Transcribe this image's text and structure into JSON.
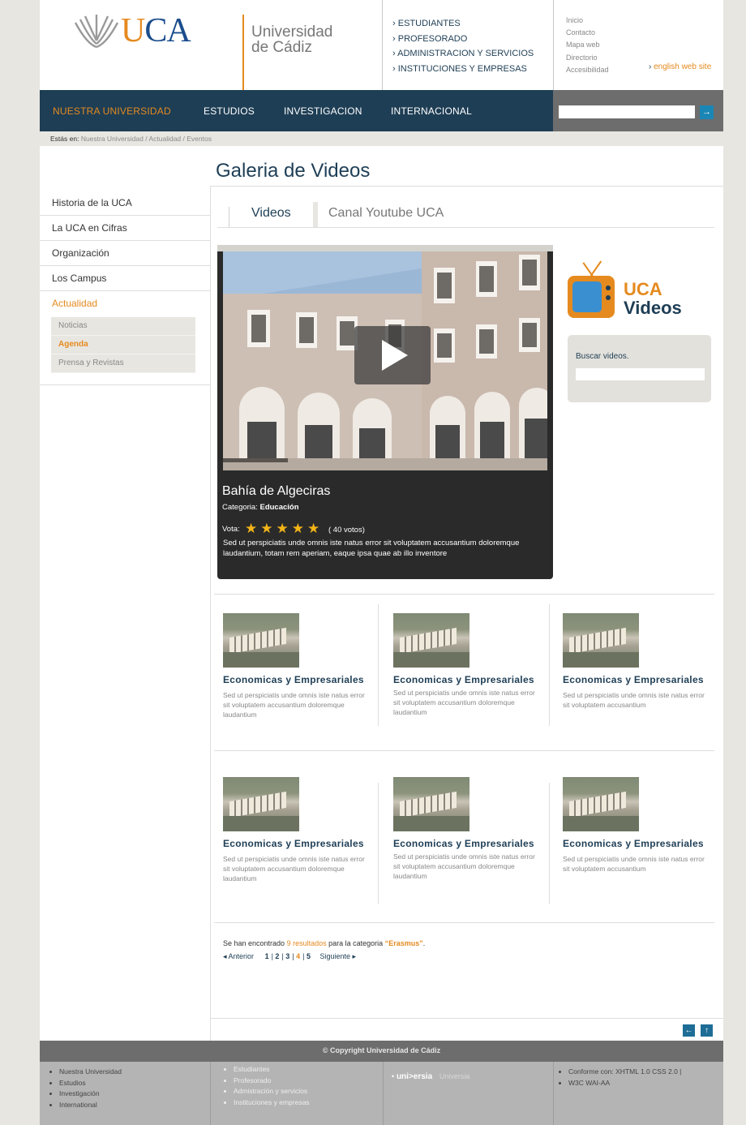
{
  "header": {
    "logo_text_u": "U",
    "logo_text_ca": "CA",
    "logo_name_line1": "Universidad",
    "logo_name_line2": "de Cádiz",
    "top_links": [
      "ESTUDIANTES",
      "PROFESORADO",
      "ADMINISTRACION Y SERVICIOS",
      "INSTITUCIONES Y EMPRESAS"
    ],
    "utility_links": [
      "Inicio",
      "Contacto",
      "Mapa web",
      "Directorio",
      "Accesibilidad"
    ],
    "english_link": "english web site"
  },
  "nav": {
    "items": [
      "NUESTRA  UNIVERSIDAD",
      "ESTUDIOS",
      "INVESTIGACION",
      "INTERNACIONAL"
    ],
    "active_index": 0,
    "search_placeholder": "",
    "search_button": "→"
  },
  "breadcrumb": {
    "prefix": "Estás en:",
    "items": [
      "Nuestra Universidad",
      "Actualidad",
      "Eventos"
    ]
  },
  "page_title": "Galeria de Videos",
  "sidebar": {
    "items": [
      "Historia de la UCA",
      "La UCA en Cifras",
      "Organización",
      "Los Campus",
      "Actualidad"
    ],
    "active_index": 4,
    "subitems": [
      "Noticias",
      "Agenda",
      "Prensa y Revistas"
    ],
    "active_sub_index": 1
  },
  "tabs": [
    "Videos",
    "Canal Youtube UCA"
  ],
  "player": {
    "title": "Bahía de Algeciras",
    "category_label": "Categoria:",
    "category": "Educación",
    "vote_label": "Vota:",
    "rating": 5,
    "votes": "( 40 votos)",
    "description": "Sed ut perspiciatis unde omnis iste natus error sit voluptatem accusantium doloremque laudantium, totam rem aperiam, eaque ipsa quae ab illo inventore"
  },
  "right": {
    "logo_line1": "UCA",
    "logo_line2": "Videos",
    "search_label": "Buscar videos."
  },
  "videos": [
    {
      "title": "Economicas y Empresariales",
      "desc": "Sed ut perspiciatis unde omnis iste natus error sit voluptatem accusantium doloremque laudantium"
    },
    {
      "title": "Economicas y Empresariales",
      "desc": "Sed ut perspiciatis unde omnis iste natus error sit voluptatem accusantium doloremque laudantium"
    },
    {
      "title": "Economicas y Empresariales",
      "desc": "Sed ut perspiciatis unde omnis iste natus error sit voluptatem accusantium"
    },
    {
      "title": "Economicas y Empresariales",
      "desc": "Sed ut perspiciatis unde omnis iste natus error sit voluptatem accusantium doloremque laudantium"
    },
    {
      "title": "Economicas y Empresariales",
      "desc": "Sed ut perspiciatis unde omnis iste natus error sit voluptatem accusantium doloremque laudantium"
    },
    {
      "title": "Economicas y Empresariales",
      "desc": "Sed ut perspiciatis unde omnis iste natus error sit voluptatem accusantium"
    }
  ],
  "results": {
    "prefix": "Se han encontrado",
    "count": "9 resultados",
    "middle": "para la categoria",
    "category": "“Erasmus”",
    "suffix": "."
  },
  "pager": {
    "prev": "◂ Anterior",
    "pages": [
      "1",
      "2",
      "3",
      "4",
      "5"
    ],
    "current": "4",
    "next": "Siguiente ▸"
  },
  "footer": {
    "copyright": "© Copyright Universidad de Cádiz",
    "col1": [
      "Nuestra Universidad",
      "Estudios",
      "Investigación",
      "International"
    ],
    "col2": [
      "Estudiantes",
      "Profesorado",
      "Admistración y servicios",
      "Instituciones y empresas"
    ],
    "universia_logo": "uni>ersia",
    "universia_text": "Universia",
    "col4": [
      "Conforme con: XHTML 1.0  CSS 2.0 |",
      "W3C  WAI-AA"
    ]
  },
  "colors": {
    "brand_blue": "#1e3e55",
    "brand_orange": "#e58a1f",
    "star": "#f2b418"
  }
}
